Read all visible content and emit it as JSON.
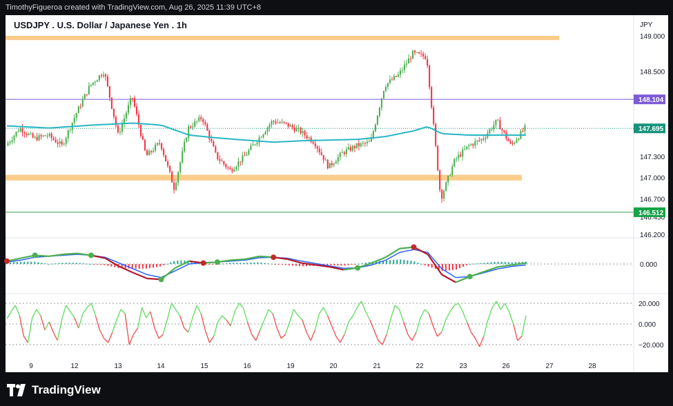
{
  "credit_text": "TimothyFigueroa created with TradingView.com, Aug 26, 2025 11:39 UTC+8",
  "brand_text": "TradingView",
  "brand_icon": "tradingview-logo-icon",
  "colors": {
    "up": "#4caf50",
    "down": "#f23645",
    "ma": "#26b5c4",
    "zone": "#f9c77d",
    "level_purple": "#7b5bd6",
    "level_green": "#2e9e4a",
    "macd_hist_up": "#26a69a",
    "macd_hist_down": "#f23645",
    "rsi_up": "#5cdb5c",
    "rsi_down": "#f04a4a"
  },
  "chart_data": {
    "type": "candlestick",
    "title": "USDJPY . U.S. Dollar / Japanese Yen . 1h",
    "price_axis_unit": "JPY",
    "price_ticks": [
      "149.000",
      "148.500",
      "148.104",
      "147.695",
      "147.300",
      "147.000",
      "146.700",
      "146.512",
      "146.450",
      "146.200"
    ],
    "price_labels": [
      {
        "value": 148.104,
        "text": "148.104",
        "color": "#7b5bd6"
      },
      {
        "value": 147.695,
        "text": "147.695",
        "color": "#17937c"
      },
      {
        "value": 146.512,
        "text": "146.512",
        "color": "#17a34a"
      }
    ],
    "ylim": [
      146.1,
      149.15
    ],
    "x_labels": [
      "9",
      "12",
      "13",
      "14",
      "15",
      "16",
      "19",
      "20",
      "21",
      "22",
      "23",
      "26",
      "27",
      "28"
    ],
    "zones": [
      {
        "from": 148.94,
        "to": 149.0
      },
      {
        "from": 146.96,
        "to": 147.04
      }
    ],
    "horizontal_levels": [
      148.104,
      146.512
    ],
    "close_line": 147.695,
    "price_path": [
      [
        0,
        147.45
      ],
      [
        1,
        147.7
      ],
      [
        2,
        147.55
      ],
      [
        3,
        147.6
      ],
      [
        4,
        147.45
      ],
      [
        5,
        147.9
      ],
      [
        6,
        148.3
      ],
      [
        7,
        148.5
      ],
      [
        8,
        147.6
      ],
      [
        9,
        148.15
      ],
      [
        10,
        147.3
      ],
      [
        11,
        147.5
      ],
      [
        12,
        146.85
      ],
      [
        13,
        147.7
      ],
      [
        14,
        147.85
      ],
      [
        15,
        147.3
      ],
      [
        16,
        147.1
      ],
      [
        17,
        147.3
      ],
      [
        18,
        147.55
      ],
      [
        19,
        147.8
      ],
      [
        20,
        147.75
      ],
      [
        21,
        147.65
      ],
      [
        22,
        147.5
      ],
      [
        23,
        147.15
      ],
      [
        24,
        147.35
      ],
      [
        25,
        147.45
      ],
      [
        26,
        147.5
      ],
      [
        27,
        148.3
      ],
      [
        28,
        148.45
      ],
      [
        29,
        148.75
      ],
      [
        30,
        148.7
      ],
      [
        31,
        146.7
      ],
      [
        32,
        147.25
      ],
      [
        33,
        147.45
      ],
      [
        34,
        147.55
      ],
      [
        35,
        147.8
      ],
      [
        36,
        147.45
      ],
      [
        37,
        147.695
      ]
    ],
    "ma_path": [
      [
        0,
        147.73
      ],
      [
        3,
        147.7
      ],
      [
        6,
        147.74
      ],
      [
        9,
        147.77
      ],
      [
        11,
        147.74
      ],
      [
        13,
        147.6
      ],
      [
        15,
        147.56
      ],
      [
        17,
        147.53
      ],
      [
        19,
        147.5
      ],
      [
        21,
        147.52
      ],
      [
        23,
        147.53
      ],
      [
        25,
        147.54
      ],
      [
        27,
        147.58
      ],
      [
        29,
        147.66
      ],
      [
        30,
        147.72
      ],
      [
        31,
        147.62
      ],
      [
        33,
        147.6
      ],
      [
        36,
        147.6
      ],
      [
        37,
        147.6
      ]
    ],
    "path_span": 37,
    "macd": {
      "zero_label": "0.000",
      "line": [
        0.06,
        0.12,
        0.18,
        0.16,
        0.2,
        0.22,
        0.18,
        0.12,
        -0.05,
        -0.18,
        -0.3,
        -0.32,
        -0.08,
        0.06,
        0.02,
        0.04,
        0.08,
        0.1,
        0.16,
        0.14,
        0.1,
        0.02,
        -0.02,
        -0.06,
        -0.12,
        -0.08,
        0.02,
        0.14,
        0.32,
        0.35,
        0.2,
        -0.22,
        -0.38,
        -0.26,
        -0.16,
        -0.06,
        -0.02,
        0.02
      ],
      "signal": [
        0.04,
        0.08,
        0.14,
        0.16,
        0.18,
        0.2,
        0.18,
        0.14,
        0.02,
        -0.1,
        -0.22,
        -0.28,
        -0.14,
        0.0,
        0.03,
        0.04,
        0.06,
        0.08,
        0.13,
        0.14,
        0.12,
        0.06,
        0.01,
        -0.04,
        -0.09,
        -0.08,
        -0.02,
        0.08,
        0.24,
        0.3,
        0.24,
        -0.1,
        -0.28,
        -0.26,
        -0.18,
        -0.1,
        -0.05,
        -0.02
      ],
      "crosses": [
        {
          "i": 0,
          "dir": "down"
        },
        {
          "i": 2,
          "dir": "up"
        },
        {
          "i": 6,
          "dir": "up"
        },
        {
          "i": 11,
          "dir": "up"
        },
        {
          "i": 14,
          "dir": "down"
        },
        {
          "i": 15,
          "dir": "up"
        },
        {
          "i": 19,
          "dir": "down"
        },
        {
          "i": 25,
          "dir": "up"
        },
        {
          "i": 29,
          "dir": "down"
        },
        {
          "i": 33,
          "dir": "up"
        }
      ]
    },
    "rsi": {
      "tick_labels": [
        "20.000",
        "0.000",
        "−20.000"
      ],
      "levels": [
        20,
        0,
        -20
      ],
      "values": [
        5,
        12,
        18,
        8,
        -12,
        -18,
        6,
        14,
        8,
        -6,
        2,
        -8,
        -16,
        4,
        18,
        12,
        6,
        -4,
        10,
        16,
        20,
        8,
        -6,
        -14,
        -18,
        -8,
        4,
        14,
        10,
        -20,
        -10,
        -4,
        16,
        6,
        12,
        -4,
        -14,
        -10,
        4,
        20,
        14,
        8,
        -4,
        -8,
        6,
        18,
        10,
        -6,
        -18,
        -12,
        2,
        8,
        4,
        -2,
        12,
        20,
        16,
        2,
        -10,
        -16,
        -6,
        4,
        14,
        10,
        -4,
        -14,
        -10,
        2,
        14,
        8,
        4,
        -8,
        -16,
        -6,
        10,
        16,
        8,
        -2,
        -12,
        -18,
        -10,
        2,
        8,
        16,
        22,
        12,
        4,
        -6,
        -16,
        -20,
        -10,
        6,
        18,
        14,
        2,
        -10,
        -16,
        -8,
        6,
        14,
        10,
        -2,
        -12,
        -8,
        4,
        12,
        18,
        20,
        12,
        2,
        -8,
        -14,
        -22,
        -12,
        4,
        16,
        22,
        14,
        20,
        12,
        0,
        -16,
        -12,
        8
      ]
    }
  }
}
